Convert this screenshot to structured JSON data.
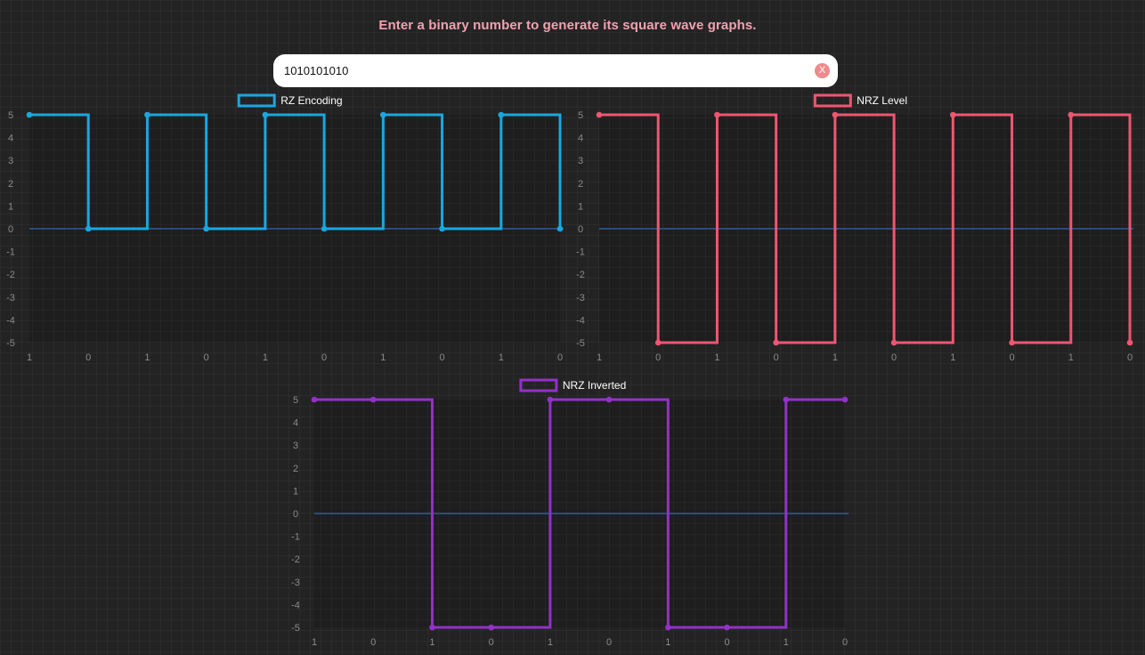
{
  "header": {
    "prompt": "Enter a binary number to generate its square wave graphs."
  },
  "input": {
    "value": "1010101010",
    "clear_label": "X"
  },
  "colors": {
    "rz": "#1aa7e0",
    "nrz_level": "#ef5671",
    "nrz_inverted": "#9331c9",
    "zero_line": "#2f5aa0",
    "tick_text": "#8a8a8a",
    "legend_text": "#ffffff"
  },
  "chart_data": [
    {
      "id": "rz",
      "type": "line",
      "stepped": true,
      "legend": "RZ Encoding",
      "categories": [
        "1",
        "0",
        "1",
        "0",
        "1",
        "0",
        "1",
        "0",
        "1",
        "0"
      ],
      "values": [
        5,
        0,
        5,
        0,
        5,
        0,
        5,
        0,
        5,
        0
      ],
      "ylim": [
        -5,
        5
      ],
      "yticks": [
        5,
        4,
        3,
        2,
        1,
        0,
        -1,
        -2,
        -3,
        -4,
        -5
      ],
      "grid": true,
      "legend_position": "top"
    },
    {
      "id": "nrz",
      "type": "line",
      "stepped": true,
      "legend": "NRZ Level",
      "categories": [
        "1",
        "0",
        "1",
        "0",
        "1",
        "0",
        "1",
        "0",
        "1",
        "0"
      ],
      "values": [
        5,
        -5,
        5,
        -5,
        5,
        -5,
        5,
        -5,
        5,
        -5
      ],
      "ylim": [
        -5,
        5
      ],
      "yticks": [
        5,
        4,
        3,
        2,
        1,
        0,
        -1,
        -2,
        -3,
        -4,
        -5
      ],
      "grid": true,
      "legend_position": "top"
    },
    {
      "id": "inv",
      "type": "line",
      "stepped": true,
      "legend": "NRZ Inverted",
      "categories": [
        "1",
        "0",
        "1",
        "0",
        "1",
        "0",
        "1",
        "0",
        "1",
        "0"
      ],
      "values": [
        5,
        5,
        -5,
        -5,
        5,
        5,
        -5,
        -5,
        5,
        5
      ],
      "ylim": [
        -5,
        5
      ],
      "yticks": [
        5,
        4,
        3,
        2,
        1,
        0,
        -1,
        -2,
        -3,
        -4,
        -5
      ],
      "grid": true,
      "legend_position": "top"
    }
  ]
}
